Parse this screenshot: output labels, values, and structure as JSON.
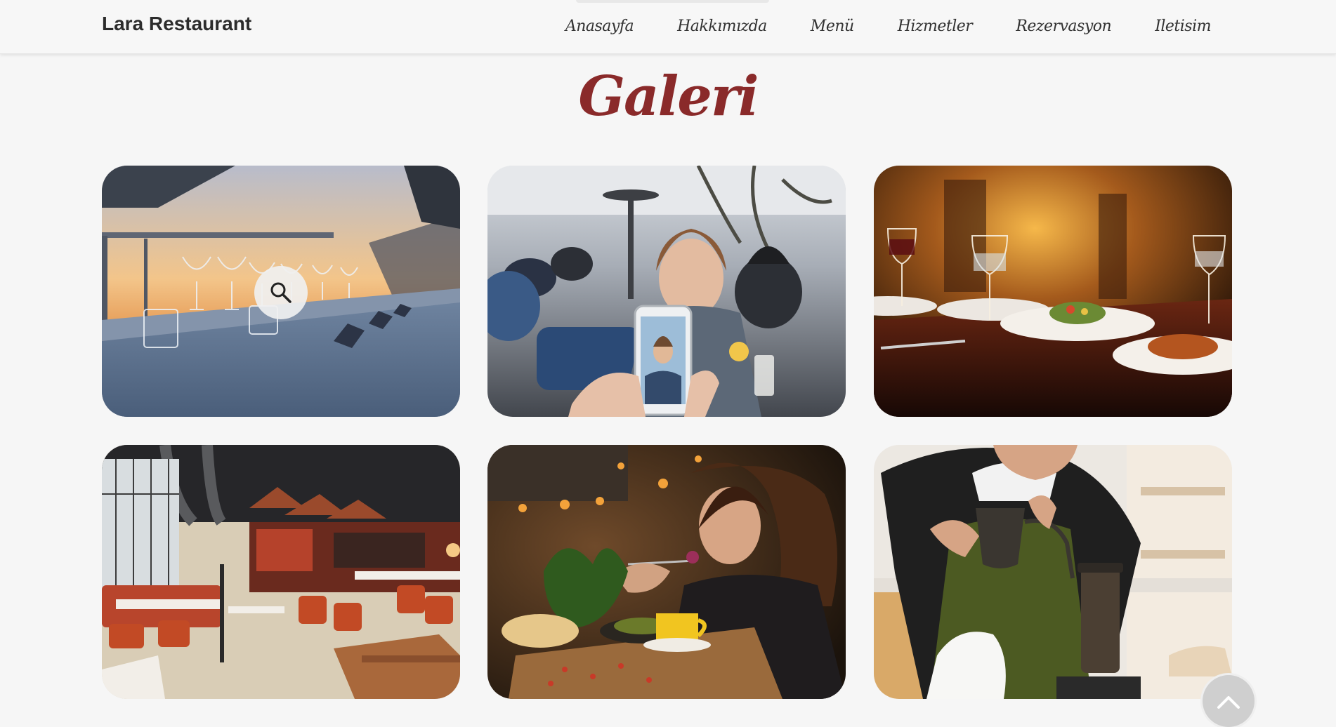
{
  "brand": "Lara Restaurant",
  "nav": [
    "Anasayfa",
    "Hakkımızda",
    "Menü",
    "Hizmetler",
    "Rezervasyon",
    "Iletisim"
  ],
  "page_title": "Galeri",
  "colors": {
    "title": "#8a2a2a",
    "background": "#f6f6f6",
    "navbar": "#f7f7f7"
  },
  "gallery": [
    {
      "scene": "rooftop dining table at sunset with wine glasses",
      "hover": true
    },
    {
      "scene": "woman smiling on terrace photographed with smartphone"
    },
    {
      "scene": "candlelit table with salads and wine"
    },
    {
      "scene": "large industrial-style restaurant interior with orange chairs"
    },
    {
      "scene": "woman enjoying a dish with yellow coffee cup"
    },
    {
      "scene": "barista pouring water from black kettle"
    }
  ],
  "icons": {
    "zoom": "search-icon",
    "scroll_top": "chevron-up-icon"
  }
}
